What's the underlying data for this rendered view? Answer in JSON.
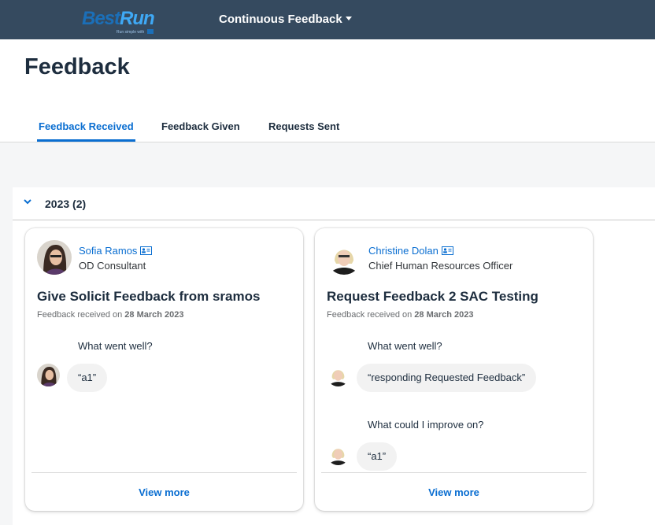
{
  "shell": {
    "logo_best": "Best",
    "logo_run": "Run",
    "logo_tagline": "Run simple with",
    "app_title": "Continuous Feedback"
  },
  "page": {
    "title": "Feedback"
  },
  "tabs": [
    {
      "label": "Feedback Received",
      "active": true
    },
    {
      "label": "Feedback Given",
      "active": false
    },
    {
      "label": "Requests Sent",
      "active": false
    }
  ],
  "group": {
    "label": "2023 (2)",
    "expanded": true
  },
  "cards": [
    {
      "name": "Sofia Ramos",
      "role": "OD Consultant",
      "title": "Give Solicit Feedback from sramos",
      "received_prefix": "Feedback received on",
      "received_date": "28 March 2023",
      "qa": [
        {
          "question": "What went well?",
          "answer": "“a1”"
        }
      ],
      "view_more": "View more"
    },
    {
      "name": "Christine Dolan",
      "role": "Chief Human Resources Officer",
      "title": "Request Feedback 2 SAC Testing",
      "received_prefix": "Feedback received on",
      "received_date": "28 March 2023",
      "qa": [
        {
          "question": "What went well?",
          "answer": "“responding Requested Feedback”"
        },
        {
          "question": "What could I improve on?",
          "answer": "“a1”"
        }
      ],
      "view_more": "View more"
    }
  ],
  "colors": {
    "shellbar": "#354a5f",
    "accent": "#0a6ed1",
    "page_bg": "#f5f6f7"
  },
  "icons": {
    "contact_card": "contact-card-icon",
    "group_toggle": "chevron-down-icon",
    "menu_caret": "caret-down-icon"
  }
}
